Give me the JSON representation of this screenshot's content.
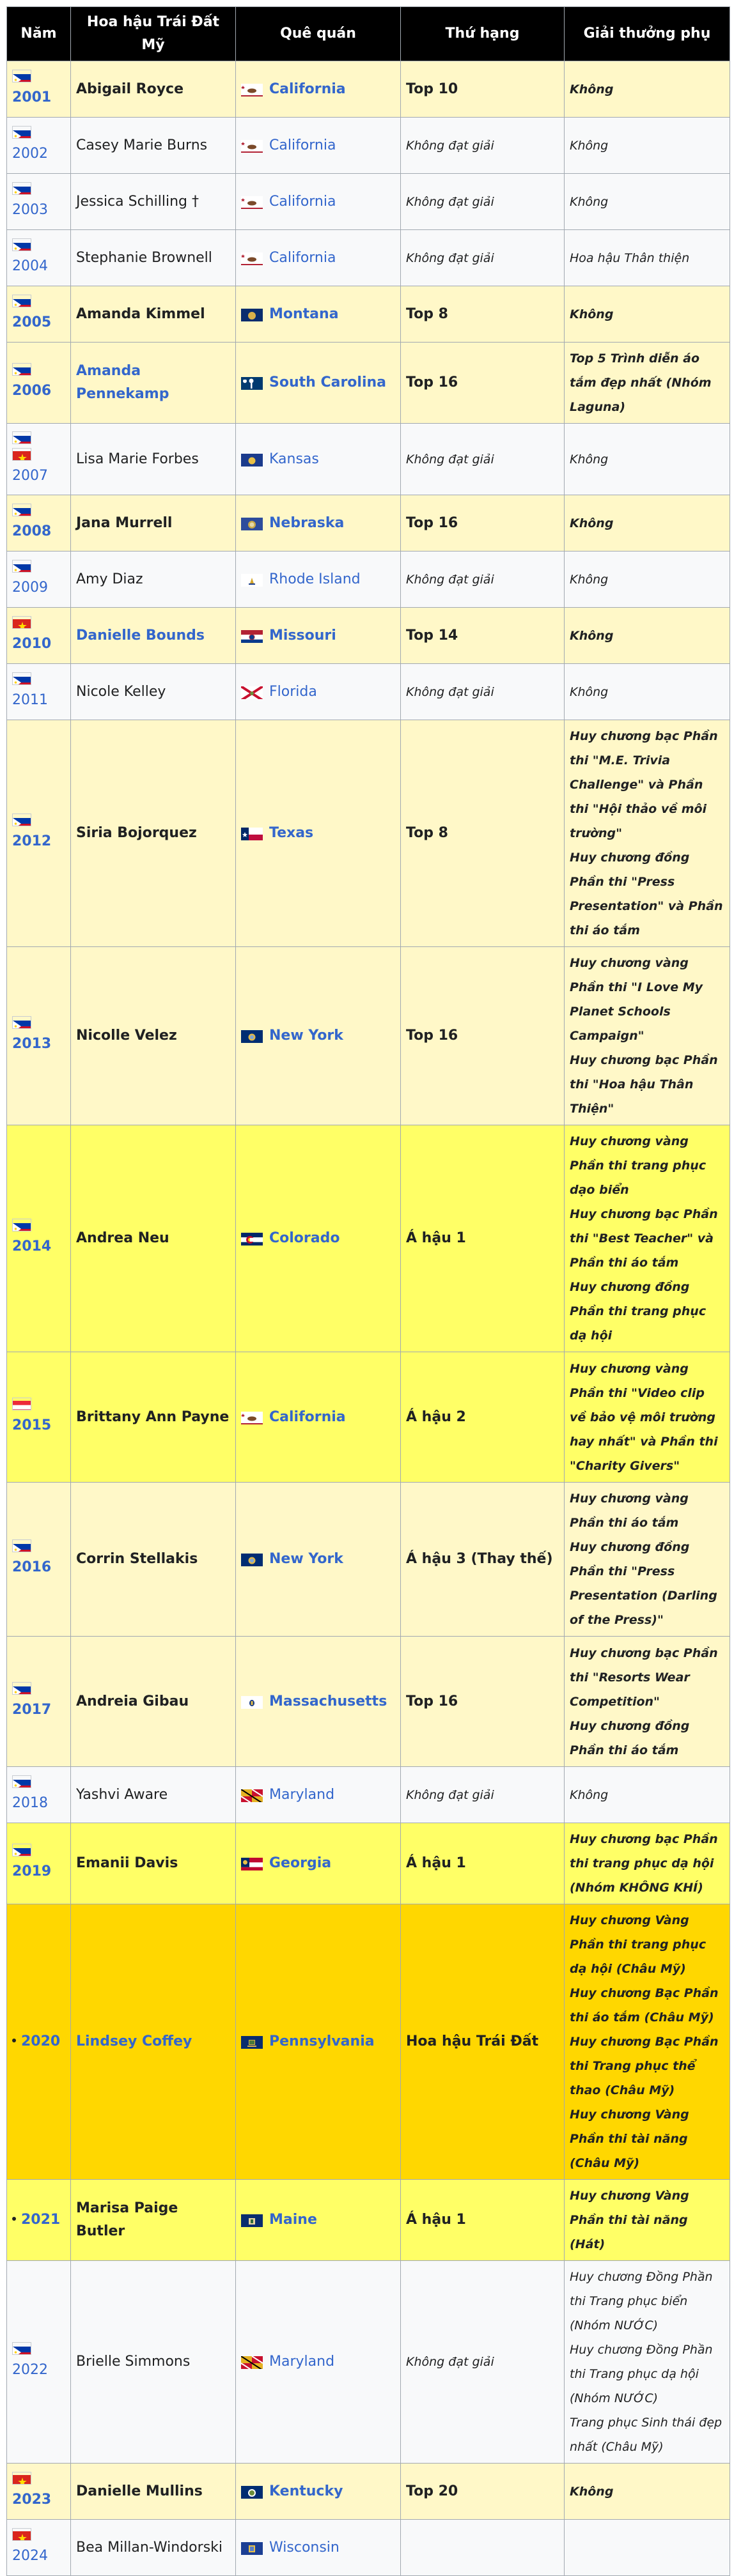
{
  "headers": [
    "Năm",
    "Hoa hậu Trái Đất Mỹ",
    "Quê quán",
    "Thứ hạng",
    "Giải thưởng phụ"
  ],
  "rows": [
    {
      "year": "2001",
      "name": "Abigail Royce",
      "name_link": false,
      "state": "California",
      "state_icon": "california-flag-icon",
      "rank": "Top 10",
      "awards": [
        "Không"
      ],
      "style": "bold",
      "bg": "cream",
      "flag": "philippines-flag-icon"
    },
    {
      "year": "2002",
      "name": "Casey Marie Burns",
      "name_link": false,
      "state": "California",
      "state_icon": "california-flag-icon",
      "rank": "Không đạt giải",
      "awards": [
        "Không"
      ],
      "style": "normal",
      "bg": "white",
      "flag": "philippines-flag-icon"
    },
    {
      "year": "2003",
      "name": "Jessica Schilling †",
      "name_link": false,
      "state": "California",
      "state_icon": "california-flag-icon",
      "rank": "Không đạt giải",
      "awards": [
        "Không"
      ],
      "style": "normal",
      "bg": "white",
      "flag": "philippines-flag-icon"
    },
    {
      "year": "2004",
      "name": "Stephanie Brownell",
      "name_link": false,
      "state": "California",
      "state_icon": "california-flag-icon",
      "rank": "Không đạt giải",
      "awards": [
        "Hoa hậu Thân thiện"
      ],
      "style": "normal",
      "bg": "white",
      "flag": "philippines-flag-icon"
    },
    {
      "year": "2005",
      "name": "Amanda Kimmel",
      "name_link": false,
      "state": "Montana",
      "state_icon": "montana-flag-icon",
      "rank": "Top 8",
      "awards": [
        "Không"
      ],
      "style": "bold",
      "bg": "cream",
      "flag": "philippines-flag-icon"
    },
    {
      "year": "2006",
      "name": "Amanda Pennekamp",
      "name_link": true,
      "state": "South Carolina",
      "state_icon": "south-carolina-flag-icon",
      "rank": "Top 16",
      "awards": [
        "Top 5 Trình diễn áo tắm đẹp nhất (Nhóm Laguna)"
      ],
      "style": "bold",
      "bg": "cream",
      "flag": "philippines-flag-icon"
    },
    {
      "year": "2007",
      "name": "Lisa Marie Forbes",
      "name_link": false,
      "state": "Kansas",
      "state_icon": "kansas-flag-icon",
      "rank": "Không đạt giải",
      "awards": [
        "Không"
      ],
      "style": "normal",
      "bg": "white",
      "flag": "philippines-vietnam-flags-icon"
    },
    {
      "year": "2008",
      "name": "Jana Murrell",
      "name_link": false,
      "state": "Nebraska",
      "state_icon": "nebraska-flag-icon",
      "rank": "Top 16",
      "awards": [
        "Không"
      ],
      "style": "bold",
      "bg": "cream",
      "flag": "philippines-flag-icon"
    },
    {
      "year": "2009",
      "name": "Amy Diaz",
      "name_link": false,
      "state": "Rhode Island",
      "state_icon": "rhode-island-flag-icon",
      "rank": "Không đạt giải",
      "awards": [
        "Không"
      ],
      "style": "normal",
      "bg": "white",
      "flag": "philippines-flag-icon"
    },
    {
      "year": "2010",
      "name": "Danielle Bounds",
      "name_link": true,
      "state": "Missouri",
      "state_icon": "missouri-flag-icon",
      "rank": "Top 14",
      "awards": [
        "Không"
      ],
      "style": "bold",
      "bg": "cream",
      "flag": "vietnam-flag-icon"
    },
    {
      "year": "2011",
      "name": "Nicole Kelley",
      "name_link": false,
      "state": "Florida",
      "state_icon": "florida-flag-icon",
      "rank": "Không đạt giải",
      "awards": [
        "Không"
      ],
      "style": "normal",
      "bg": "white",
      "flag": "philippines-flag-icon"
    },
    {
      "year": "2012",
      "name": "Siria Bojorquez",
      "name_link": false,
      "state": "Texas",
      "state_icon": "texas-flag-icon",
      "rank": "Top 8",
      "awards": [
        "Huy chương bạc Phần thi \"M.E. Trivia Challenge\" và Phần thi \"Hội thảo về môi trường\"",
        "Huy chương đồng Phần thi \"Press Presentation\" và Phần thi áo tắm"
      ],
      "style": "bold",
      "bg": "cream",
      "flag": "philippines-flag-icon"
    },
    {
      "year": "2013",
      "name": "Nicolle Velez",
      "name_link": false,
      "state": "New York",
      "state_icon": "new-york-flag-icon",
      "rank": "Top 16",
      "awards": [
        "Huy chương vàng Phần thi \"I Love My Planet Schools Campaign\"",
        "Huy chương bạc Phần thi \"Hoa hậu Thân Thiện\""
      ],
      "style": "bold",
      "bg": "cream",
      "flag": "philippines-flag-icon"
    },
    {
      "year": "2014",
      "name": "Andrea Neu",
      "name_link": false,
      "state": "Colorado",
      "state_icon": "colorado-flag-icon",
      "rank": "Á hậu 1",
      "awards": [
        "Huy chương vàng Phần thi trang phục dạo biển",
        "Huy chương bạc Phần thi \"Best Teacher\" và Phần thi áo tắm",
        "Huy chương đồng Phần thi trang phục dạ hội"
      ],
      "style": "bold",
      "bg": "yellow",
      "flag": "philippines-flag-icon"
    },
    {
      "year": "2015",
      "name": "Brittany Ann Payne",
      "name_link": false,
      "state": "California",
      "state_icon": "california-flag-icon",
      "rank": "Á hậu 2",
      "awards": [
        "Huy chương vàng Phần thi \"Video clip về bảo vệ môi trường hay nhất\" và Phần thi \"Charity Givers\""
      ],
      "style": "bold",
      "bg": "yellow",
      "flag": "austria-flag-icon"
    },
    {
      "year": "2016",
      "name": "Corrin Stellakis",
      "name_link": false,
      "state": "New York",
      "state_icon": "new-york-flag-icon",
      "rank": "Á hậu 3 (Thay thế)",
      "awards": [
        "Huy chương vàng Phần thi áo tắm",
        "Huy chương đồng Phần thi \"Press Presentation (Darling of the Press)\""
      ],
      "style": "bold",
      "bg": "cream",
      "flag": "philippines-flag-icon"
    },
    {
      "year": "2017",
      "name": "Andreia Gibau",
      "name_link": false,
      "state": "Massachusetts",
      "state_icon": "massachusetts-flag-icon",
      "rank": "Top 16",
      "awards": [
        "Huy chương bạc Phần thi \"Resorts Wear Competition\"",
        "Huy chương đồng Phần thi áo tắm"
      ],
      "style": "bold",
      "bg": "cream",
      "flag": "philippines-flag-icon"
    },
    {
      "year": "2018",
      "name": "Yashvi Aware",
      "name_link": false,
      "state": "Maryland",
      "state_icon": "maryland-flag-icon",
      "rank": "Không đạt giải",
      "awards": [
        "Không"
      ],
      "style": "normal",
      "bg": "white",
      "flag": "philippines-flag-icon"
    },
    {
      "year": "2019",
      "name": "Emanii Davis",
      "name_link": false,
      "state": "Georgia",
      "state_icon": "georgia-flag-icon",
      "rank": "Á hậu 1",
      "awards": [
        "Huy chương bạc Phần thi trang phục dạ hội (Nhóm KHÔNG KHÍ)"
      ],
      "style": "bold",
      "bg": "yellow",
      "flag": "philippines-flag-icon"
    },
    {
      "year": "2020",
      "name": "Lindsey Coffey",
      "name_link": true,
      "state": "Pennsylvania",
      "state_icon": "pennsylvania-flag-icon",
      "rank": "Hoa hậu Trái Đất",
      "awards": [
        "Huy chương Vàng Phần thi trang phục dạ hội (Châu Mỹ)",
        "Huy chương Bạc Phần thi áo tắm (Châu Mỹ)",
        "Huy chương Bạc Phần thi Trang phục thể thao (Châu Mỹ)",
        "Huy chương Vàng Phần thi tài năng (Châu Mỹ)"
      ],
      "style": "bold",
      "bg": "gold",
      "flag": "bullet"
    },
    {
      "year": "2021",
      "name": "Marisa Paige Butler",
      "name_link": false,
      "state": "Maine",
      "state_icon": "maine-flag-icon",
      "rank": "Á hậu 1",
      "awards": [
        "Huy chương Vàng Phần thi tài năng (Hát)"
      ],
      "style": "bold",
      "bg": "yellow",
      "flag": "bullet"
    },
    {
      "year": "2022",
      "name": "Brielle Simmons",
      "name_link": false,
      "state": "Maryland",
      "state_icon": "maryland-flag-icon",
      "rank": "Không đạt giải",
      "awards": [
        "Huy chương Đồng Phần thi Trang phục biển (Nhóm NƯỚC)",
        "Huy chương Đồng Phần thi Trang phục dạ hội (Nhóm NƯỚC)",
        "Trang phục Sinh thái đẹp nhất (Châu Mỹ)"
      ],
      "style": "normal",
      "bg": "white",
      "flag": "philippines-flag-icon"
    },
    {
      "year": "2023",
      "name": "Danielle Mullins",
      "name_link": false,
      "state": "Kentucky",
      "state_icon": "kentucky-flag-icon",
      "rank": "Top 20",
      "awards": [
        "Không"
      ],
      "style": "bold",
      "bg": "cream",
      "flag": "vietnam-flag-icon"
    },
    {
      "year": "2024",
      "name": "Bea Millan-Windorski",
      "name_link": false,
      "state": "Wisconsin",
      "state_icon": "wisconsin-flag-icon",
      "rank": "",
      "awards": [],
      "style": "normal",
      "bg": "white",
      "flag": "vietnam-flag-icon"
    }
  ]
}
